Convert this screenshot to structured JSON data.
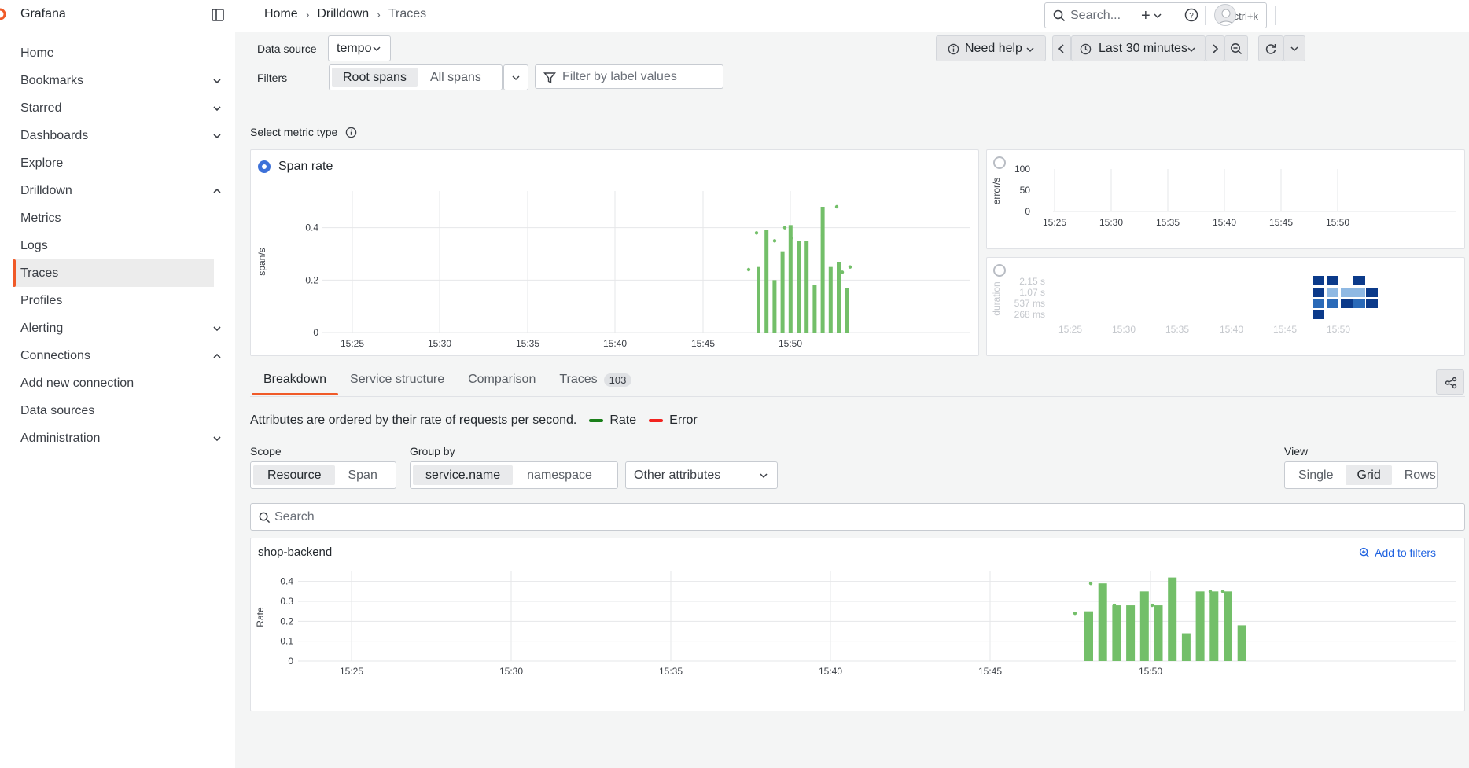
{
  "app": {
    "name": "Grafana"
  },
  "sidebar": {
    "items": [
      {
        "label": "Home",
        "chevron": ""
      },
      {
        "label": "Bookmarks",
        "chevron": "down"
      },
      {
        "label": "Starred",
        "chevron": "down"
      },
      {
        "label": "Dashboards",
        "chevron": "down"
      },
      {
        "label": "Explore",
        "chevron": ""
      },
      {
        "label": "Drilldown",
        "chevron": "up"
      },
      {
        "label": "Metrics",
        "chevron": ""
      },
      {
        "label": "Logs",
        "chevron": ""
      },
      {
        "label": "Traces",
        "chevron": "",
        "active": true
      },
      {
        "label": "Profiles",
        "chevron": ""
      },
      {
        "label": "Alerting",
        "chevron": "down"
      },
      {
        "label": "Connections",
        "chevron": "up"
      },
      {
        "label": "Add new connection",
        "chevron": ""
      },
      {
        "label": "Data sources",
        "chevron": ""
      },
      {
        "label": "Administration",
        "chevron": "down"
      }
    ]
  },
  "topbar": {
    "breadcrumbs": [
      "Home",
      "Drilldown",
      "Traces"
    ],
    "search_placeholder": "Search...",
    "search_shortcut": "ctrl+k"
  },
  "controls": {
    "data_source_label": "Data source",
    "data_source_value": "tempo",
    "filters_label": "Filters",
    "span_toggle": [
      "Root spans",
      "All spans"
    ],
    "filter_placeholder": "Filter by label values",
    "need_help": "Need help",
    "time_range": "Last 30 minutes"
  },
  "metric_type": {
    "label": "Select metric type",
    "span_rate_title": "Span rate"
  },
  "tabs": [
    {
      "label": "Breakdown"
    },
    {
      "label": "Service structure"
    },
    {
      "label": "Comparison"
    },
    {
      "label": "Traces",
      "count": "103"
    }
  ],
  "breakdown": {
    "description": "Attributes are ordered by their rate of requests per second.",
    "legend_rate": "Rate",
    "legend_error": "Error",
    "scope_label": "Scope",
    "scope_options": [
      "Resource",
      "Span"
    ],
    "group_label": "Group by",
    "group_options": [
      "service.name",
      "namespace"
    ],
    "other_attributes": "Other attributes",
    "view_label": "View",
    "view_options": [
      "Single",
      "Grid",
      "Rows"
    ],
    "search_placeholder": "Search",
    "service_panel_title": "shop-backend",
    "add_to_filters": "Add to filters"
  },
  "colors": {
    "accent": "#f05a28",
    "bar_green": "#73bf69",
    "blue": "#3d71d9",
    "rate_line": "#1a7f1a",
    "error_line": "#f2231f"
  },
  "chart_data": [
    {
      "type": "bar",
      "title": "Span rate",
      "ylabel": "span/s",
      "x_ticks": [
        "15:25",
        "15:30",
        "15:35",
        "15:40",
        "15:45",
        "15:50"
      ],
      "y_ticks": [
        "0",
        "0.2",
        "0.4"
      ],
      "ylim": [
        0,
        0.54
      ],
      "x": [
        "15:48:30",
        "15:49",
        "15:49:30",
        "15:50",
        "15:50:30",
        "15:51",
        "15:51:30",
        "15:52",
        "15:52:30",
        "15:53"
      ],
      "values": [
        0.25,
        0.39,
        0.2,
        0.31,
        0.41,
        0.35,
        0.35,
        0.18,
        0.48,
        0.25,
        0.27,
        0.17
      ]
    },
    {
      "type": "line",
      "ylabel": "error/s",
      "x_ticks": [
        "15:25",
        "15:30",
        "15:35",
        "15:40",
        "15:45",
        "15:50"
      ],
      "y_ticks": [
        "0",
        "50",
        "100"
      ],
      "ylim": [
        0,
        100
      ]
    },
    {
      "type": "heatmap",
      "ylabel": "duration",
      "y_ticks": [
        "268 ms",
        "537 ms",
        "1.07 s",
        "2.15 s"
      ],
      "x_ticks": [
        "15:25",
        "15:30",
        "15:35",
        "15:40",
        "15:45",
        "15:50"
      ]
    },
    {
      "type": "bar",
      "title": "shop-backend",
      "ylabel": "Rate",
      "x_ticks": [
        "15:25",
        "15:30",
        "15:35",
        "15:40",
        "15:45",
        "15:50"
      ],
      "y_ticks": [
        "0",
        "0.1",
        "0.2",
        "0.3",
        "0.4"
      ],
      "ylim": [
        0,
        0.45
      ],
      "values": [
        0.25,
        0.39,
        0.28,
        0.28,
        0.35,
        0.28,
        0.42,
        0.14,
        0.35,
        0.35,
        0.35,
        0.18
      ]
    }
  ]
}
